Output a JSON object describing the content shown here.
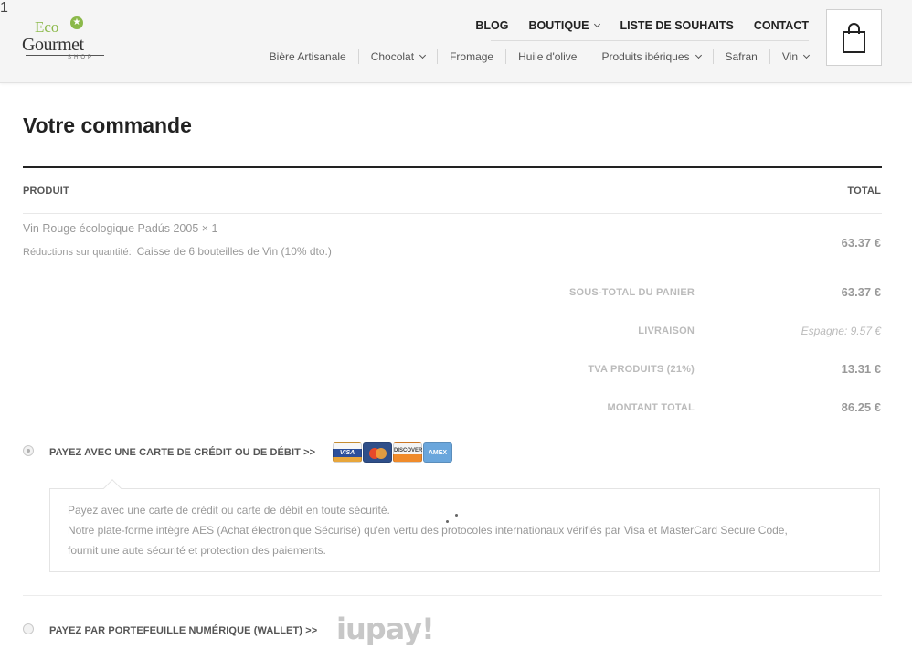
{
  "header": {
    "logo": {
      "eco": "Eco",
      "gourmet": "Gourmet",
      "shop": "SHOP"
    },
    "top_nav": [
      {
        "label": "BLOG",
        "dropdown": false
      },
      {
        "label": "BOUTIQUE",
        "dropdown": true
      },
      {
        "label": "LISTE DE SOUHAITS",
        "dropdown": false
      },
      {
        "label": "CONTACT",
        "dropdown": false
      }
    ],
    "sub_nav": [
      {
        "label": "Bière Artisanale",
        "dropdown": false
      },
      {
        "label": "Chocolat",
        "dropdown": true
      },
      {
        "label": "Fromage",
        "dropdown": false
      },
      {
        "label": "Huile d'olive",
        "dropdown": false
      },
      {
        "label": "Produits ibériques",
        "dropdown": true
      },
      {
        "label": "Safran",
        "dropdown": false
      },
      {
        "label": "Vin",
        "dropdown": true
      }
    ],
    "cart": {
      "count": "1",
      "icon": "shopping-bag-icon"
    }
  },
  "order": {
    "title": "Votre commande",
    "col_product": "PRODUIT",
    "col_total": "TOTAL",
    "item": {
      "name": "Vin Rouge écologique Padús 2005 × 1",
      "meta_label": "Réductions sur quantité:",
      "meta_value": "Caisse de 6 bouteilles de Vin (10% dto.)",
      "total": "63.37 €"
    },
    "summary": [
      {
        "label": "SOUS-TOTAL DU PANIER",
        "value": "63.37 €"
      },
      {
        "label": "LIVRAISON",
        "value": "Espagne: 9.57 €"
      },
      {
        "label": "TVA PRODUITS (21%)",
        "value": "13.31 €"
      },
      {
        "label": "MONTANT TOTAL",
        "value": "86.25 €"
      }
    ]
  },
  "payment": {
    "card": {
      "label": "PAYEZ AVEC UNE CARTE DE CRÉDIT OU DE DÉBIT >>",
      "selected": true,
      "logos": [
        "VISA",
        "MasterCard",
        "DISCOVER",
        "AMEX"
      ],
      "description": [
        "Payez avec une carte de crédit ou carte de débit en toute sécurité.",
        "Notre plate-forme intègre AES (Achat électronique Sécurisé) qu'en vertu des protocoles internationaux vérifiés par Visa et MasterCard Secure Code,",
        "fournit une aute sécurité et protection des paiements."
      ]
    },
    "wallet": {
      "label": "PAYEZ PAR PORTEFEUILLE NUMÉRIQUE (WALLET) >>",
      "selected": false,
      "brand": "iupay!"
    }
  }
}
